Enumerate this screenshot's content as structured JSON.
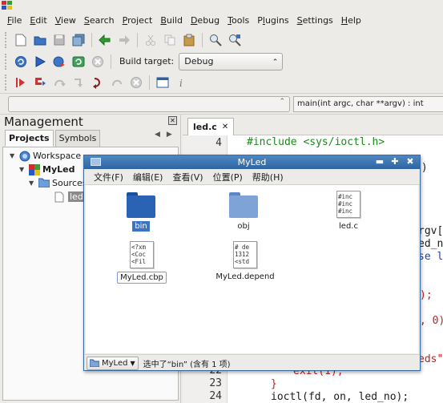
{
  "menubar": [
    "File",
    "Edit",
    "View",
    "Search",
    "Project",
    "Build",
    "Debug",
    "Tools",
    "Plugins",
    "Settings",
    "Help"
  ],
  "menubar_mnemonic": [
    "F",
    "E",
    "V",
    "S",
    "P",
    "B",
    "D",
    "T",
    "l",
    "S",
    "H"
  ],
  "toolbar2": {
    "build_target_label": "Build target:",
    "build_target_value": "Debug"
  },
  "code_completion": {
    "scope": "",
    "function": "main(int argc, char **argv) : int"
  },
  "management": {
    "title": "Management",
    "tabs": [
      "Projects",
      "Symbols"
    ],
    "tree": {
      "workspace": "Workspace",
      "project": "MyLed",
      "sources": "Sources",
      "file": "led.c"
    }
  },
  "editor": {
    "tab_label": "led.c",
    "lines": [
      {
        "num": "4",
        "text": "#include <sys/ioctl.h>"
      },
      {
        "num": "22",
        "text": "exit(1);"
      },
      {
        "num": "23",
        "text": "}"
      },
      {
        "num": "24",
        "text": "ioctl(fd, on, led_no);"
      }
    ],
    "fragments": [
      "v)",
      "rgv[",
      "ed_n",
      "se l",
      ");",
      ", 0)",
      "eds\""
    ]
  },
  "file_manager": {
    "title": "MyLed",
    "menu": [
      "文件(F)",
      "编辑(E)",
      "查看(V)",
      "位置(P)",
      "帮助(H)"
    ],
    "items": [
      {
        "name": "bin",
        "type": "folder",
        "selected": true
      },
      {
        "name": "obj",
        "type": "folder",
        "selected": false
      },
      {
        "name": "led.c",
        "type": "text",
        "preview": "#inc\n#inc\n#inc",
        "selected": false
      },
      {
        "name": "MyLed.cbp",
        "type": "text",
        "preview": "<?xm\n<Coc\n<Fil",
        "selected": false
      },
      {
        "name": "MyLed.depend",
        "type": "text",
        "preview": "# de\n1312\n<std",
        "selected": false
      }
    ],
    "status": {
      "path_button": "MyLed",
      "text": "选中了“bin” (含有 1 项)"
    }
  },
  "colors": {
    "accent_blue": "#2e64a2",
    "folder_blue": "#2a63b4",
    "folder_light": "#7ea3d6",
    "include_green": "#1a8a1a",
    "keyword_red": "#c71c1c"
  }
}
